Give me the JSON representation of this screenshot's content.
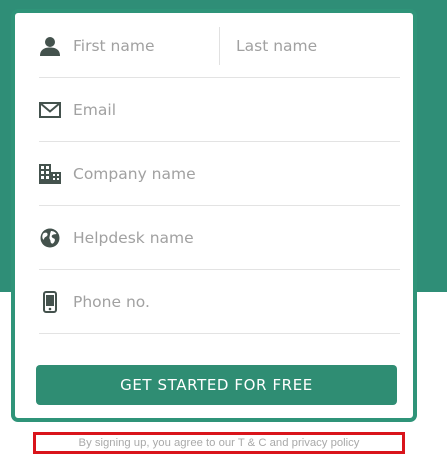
{
  "colors": {
    "brand": "#2f8e77",
    "card_border": "#2f9479",
    "button": "#2f8d73",
    "icon": "#44524d",
    "highlight_box": "#d9141b"
  },
  "form": {
    "first_name": {
      "placeholder": "First name",
      "icon": "person-icon"
    },
    "last_name": {
      "placeholder": "Last name"
    },
    "email": {
      "placeholder": "Email",
      "icon": "envelope-icon"
    },
    "company": {
      "placeholder": "Company name",
      "icon": "building-icon"
    },
    "helpdesk": {
      "placeholder": "Helpdesk name",
      "icon": "globe-icon"
    },
    "phone": {
      "placeholder": "Phone no.",
      "icon": "phone-icon"
    },
    "submit_label": "GET STARTED FOR FREE"
  },
  "terms": {
    "prefix": "By signing up, you agree to our ",
    "tnc_label": "T & C",
    "joiner": " and ",
    "privacy_label": "privacy policy"
  }
}
